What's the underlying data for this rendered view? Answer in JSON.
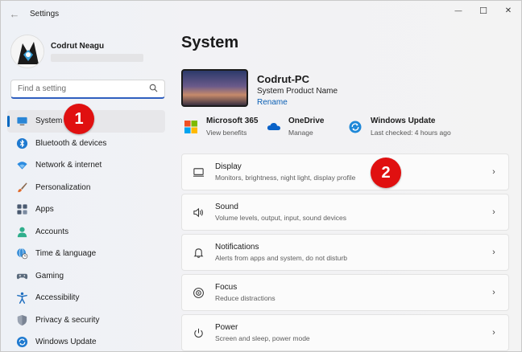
{
  "window": {
    "title": "Settings",
    "back_glyph": "←",
    "minimize_glyph": "—",
    "maximize_glyph": "☐",
    "close_glyph": "✕"
  },
  "user": {
    "name": "Codrut Neagu"
  },
  "search": {
    "placeholder": "Find a setting",
    "icon": "search-icon"
  },
  "sidebar": {
    "items": [
      {
        "label": "System",
        "icon": "monitor-icon",
        "active": true
      },
      {
        "label": "Bluetooth & devices",
        "icon": "bluetooth-icon"
      },
      {
        "label": "Network & internet",
        "icon": "wifi-icon"
      },
      {
        "label": "Personalization",
        "icon": "brush-icon"
      },
      {
        "label": "Apps",
        "icon": "apps-icon"
      },
      {
        "label": "Accounts",
        "icon": "person-icon"
      },
      {
        "label": "Time & language",
        "icon": "globe-clock-icon"
      },
      {
        "label": "Gaming",
        "icon": "gamepad-icon"
      },
      {
        "label": "Accessibility",
        "icon": "accessibility-icon"
      },
      {
        "label": "Privacy & security",
        "icon": "shield-icon"
      },
      {
        "label": "Windows Update",
        "icon": "update-icon"
      }
    ]
  },
  "annotations": {
    "marker1": "1",
    "marker2": "2"
  },
  "main": {
    "title": "System",
    "device": {
      "name": "Codrut-PC",
      "subtitle": "System Product Name",
      "rename": "Rename"
    },
    "quick": [
      {
        "title": "Microsoft 365",
        "sub": "View benefits",
        "icon": "microsoft-logo-icon"
      },
      {
        "title": "OneDrive",
        "sub": "Manage",
        "icon": "onedrive-cloud-icon"
      },
      {
        "title": "Windows Update",
        "sub": "Last checked: 4 hours ago",
        "icon": "windows-update-icon"
      }
    ],
    "cards": [
      {
        "title": "Display",
        "sub": "Monitors, brightness, night light, display profile",
        "icon": "display-icon"
      },
      {
        "title": "Sound",
        "sub": "Volume levels, output, input, sound devices",
        "icon": "speaker-icon"
      },
      {
        "title": "Notifications",
        "sub": "Alerts from apps and system, do not disturb",
        "icon": "bell-icon"
      },
      {
        "title": "Focus",
        "sub": "Reduce distractions",
        "icon": "focus-icon"
      },
      {
        "title": "Power",
        "sub": "Screen and sleep, power mode",
        "icon": "power-icon"
      }
    ],
    "chevron": "›"
  },
  "colors": {
    "accent": "#0067c0",
    "marker": "#e01010"
  }
}
